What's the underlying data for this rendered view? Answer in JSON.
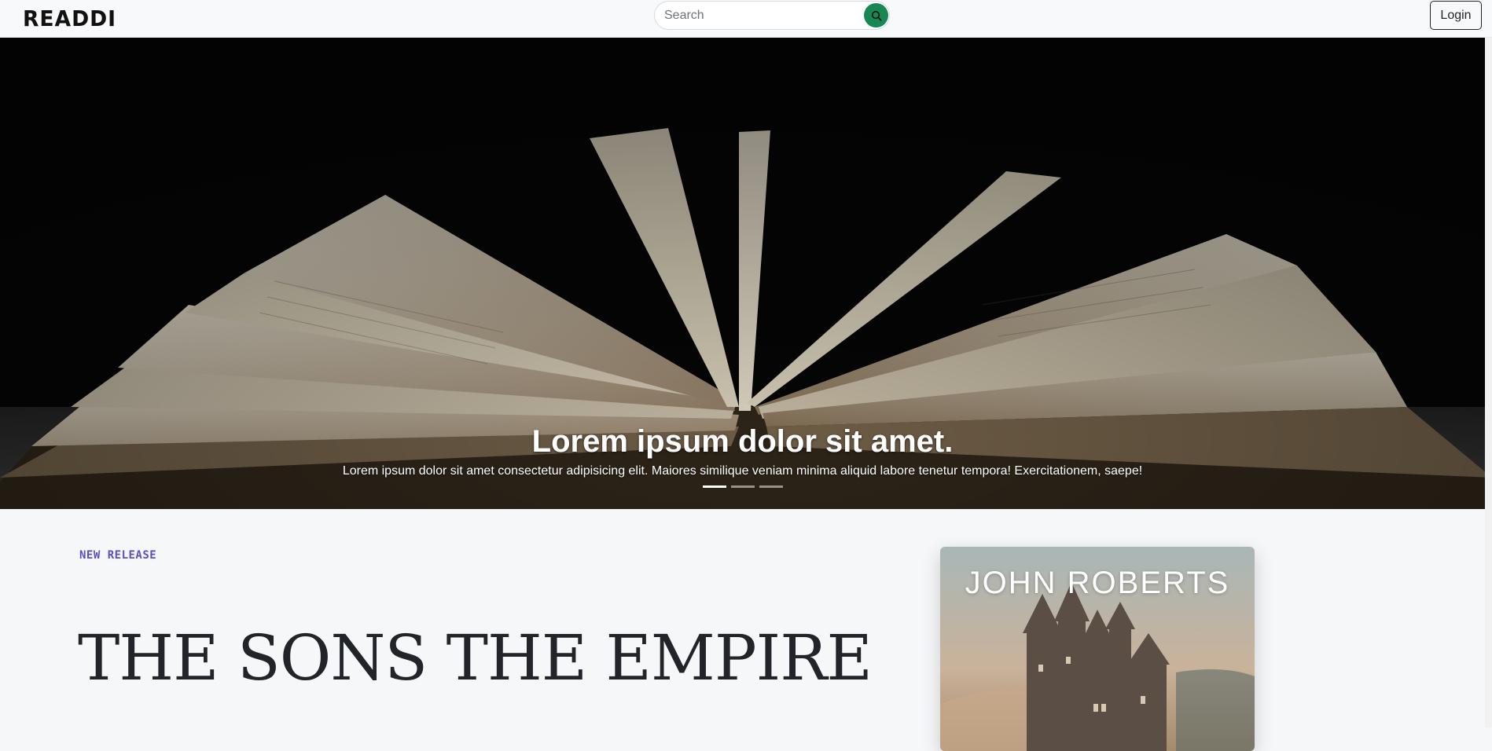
{
  "nav": {
    "logo_text": "READDI",
    "search": {
      "placeholder": "Search",
      "icon": "search-icon"
    },
    "login_label": "Login"
  },
  "hero": {
    "image": "open-book-photo",
    "title": "Lorem ipsum dolor sit amet.",
    "text": "Lorem ipsum dolor sit amet consectetur adipisicing elit. Maiores similique veniam minima aliquid labore tenetur tempora! Exercitationem, saepe!",
    "slides_count": 3,
    "active_slide": 1
  },
  "release": {
    "tag": "NEW RELEASE",
    "title": "THE SONS THE EMPIRE",
    "cover": {
      "author": "JOHN ROBERTS",
      "image": "castle-illustration"
    }
  },
  "colors": {
    "accent_green": "#198754",
    "tag_purple": "#5b4fc4",
    "text_dark": "#212529",
    "page_bg": "#f6f7f9"
  }
}
